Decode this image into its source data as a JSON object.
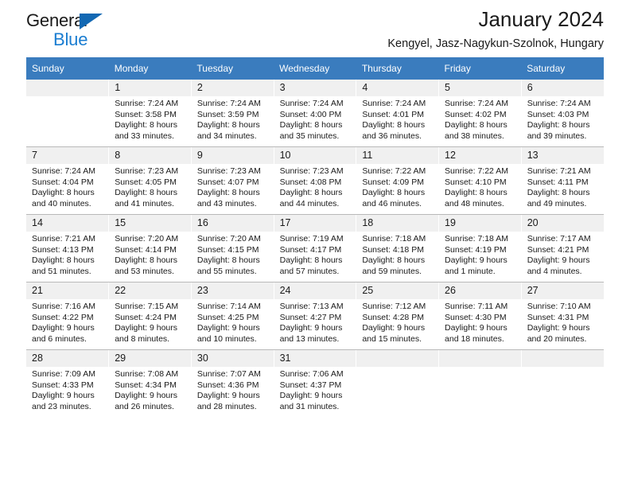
{
  "logo": {
    "word1": "General",
    "word2": "Blue",
    "triangle_color": "#1268b3",
    "word2_color": "#1a7dd1"
  },
  "header": {
    "title": "January 2024",
    "subtitle": "Kengyel, Jasz-Nagykun-Szolnok, Hungary",
    "header_bg": "#3a7cbe",
    "daynum_bg": "#f0f0f0"
  },
  "weekdays": [
    "Sunday",
    "Monday",
    "Tuesday",
    "Wednesday",
    "Thursday",
    "Friday",
    "Saturday"
  ],
  "weeks": [
    [
      {
        "day": "",
        "lines": []
      },
      {
        "day": "1",
        "lines": [
          "Sunrise: 7:24 AM",
          "Sunset: 3:58 PM",
          "Daylight: 8 hours",
          "and 33 minutes."
        ]
      },
      {
        "day": "2",
        "lines": [
          "Sunrise: 7:24 AM",
          "Sunset: 3:59 PM",
          "Daylight: 8 hours",
          "and 34 minutes."
        ]
      },
      {
        "day": "3",
        "lines": [
          "Sunrise: 7:24 AM",
          "Sunset: 4:00 PM",
          "Daylight: 8 hours",
          "and 35 minutes."
        ]
      },
      {
        "day": "4",
        "lines": [
          "Sunrise: 7:24 AM",
          "Sunset: 4:01 PM",
          "Daylight: 8 hours",
          "and 36 minutes."
        ]
      },
      {
        "day": "5",
        "lines": [
          "Sunrise: 7:24 AM",
          "Sunset: 4:02 PM",
          "Daylight: 8 hours",
          "and 38 minutes."
        ]
      },
      {
        "day": "6",
        "lines": [
          "Sunrise: 7:24 AM",
          "Sunset: 4:03 PM",
          "Daylight: 8 hours",
          "and 39 minutes."
        ]
      }
    ],
    [
      {
        "day": "7",
        "lines": [
          "Sunrise: 7:24 AM",
          "Sunset: 4:04 PM",
          "Daylight: 8 hours",
          "and 40 minutes."
        ]
      },
      {
        "day": "8",
        "lines": [
          "Sunrise: 7:23 AM",
          "Sunset: 4:05 PM",
          "Daylight: 8 hours",
          "and 41 minutes."
        ]
      },
      {
        "day": "9",
        "lines": [
          "Sunrise: 7:23 AM",
          "Sunset: 4:07 PM",
          "Daylight: 8 hours",
          "and 43 minutes."
        ]
      },
      {
        "day": "10",
        "lines": [
          "Sunrise: 7:23 AM",
          "Sunset: 4:08 PM",
          "Daylight: 8 hours",
          "and 44 minutes."
        ]
      },
      {
        "day": "11",
        "lines": [
          "Sunrise: 7:22 AM",
          "Sunset: 4:09 PM",
          "Daylight: 8 hours",
          "and 46 minutes."
        ]
      },
      {
        "day": "12",
        "lines": [
          "Sunrise: 7:22 AM",
          "Sunset: 4:10 PM",
          "Daylight: 8 hours",
          "and 48 minutes."
        ]
      },
      {
        "day": "13",
        "lines": [
          "Sunrise: 7:21 AM",
          "Sunset: 4:11 PM",
          "Daylight: 8 hours",
          "and 49 minutes."
        ]
      }
    ],
    [
      {
        "day": "14",
        "lines": [
          "Sunrise: 7:21 AM",
          "Sunset: 4:13 PM",
          "Daylight: 8 hours",
          "and 51 minutes."
        ]
      },
      {
        "day": "15",
        "lines": [
          "Sunrise: 7:20 AM",
          "Sunset: 4:14 PM",
          "Daylight: 8 hours",
          "and 53 minutes."
        ]
      },
      {
        "day": "16",
        "lines": [
          "Sunrise: 7:20 AM",
          "Sunset: 4:15 PM",
          "Daylight: 8 hours",
          "and 55 minutes."
        ]
      },
      {
        "day": "17",
        "lines": [
          "Sunrise: 7:19 AM",
          "Sunset: 4:17 PM",
          "Daylight: 8 hours",
          "and 57 minutes."
        ]
      },
      {
        "day": "18",
        "lines": [
          "Sunrise: 7:18 AM",
          "Sunset: 4:18 PM",
          "Daylight: 8 hours",
          "and 59 minutes."
        ]
      },
      {
        "day": "19",
        "lines": [
          "Sunrise: 7:18 AM",
          "Sunset: 4:19 PM",
          "Daylight: 9 hours",
          "and 1 minute."
        ]
      },
      {
        "day": "20",
        "lines": [
          "Sunrise: 7:17 AM",
          "Sunset: 4:21 PM",
          "Daylight: 9 hours",
          "and 4 minutes."
        ]
      }
    ],
    [
      {
        "day": "21",
        "lines": [
          "Sunrise: 7:16 AM",
          "Sunset: 4:22 PM",
          "Daylight: 9 hours",
          "and 6 minutes."
        ]
      },
      {
        "day": "22",
        "lines": [
          "Sunrise: 7:15 AM",
          "Sunset: 4:24 PM",
          "Daylight: 9 hours",
          "and 8 minutes."
        ]
      },
      {
        "day": "23",
        "lines": [
          "Sunrise: 7:14 AM",
          "Sunset: 4:25 PM",
          "Daylight: 9 hours",
          "and 10 minutes."
        ]
      },
      {
        "day": "24",
        "lines": [
          "Sunrise: 7:13 AM",
          "Sunset: 4:27 PM",
          "Daylight: 9 hours",
          "and 13 minutes."
        ]
      },
      {
        "day": "25",
        "lines": [
          "Sunrise: 7:12 AM",
          "Sunset: 4:28 PM",
          "Daylight: 9 hours",
          "and 15 minutes."
        ]
      },
      {
        "day": "26",
        "lines": [
          "Sunrise: 7:11 AM",
          "Sunset: 4:30 PM",
          "Daylight: 9 hours",
          "and 18 minutes."
        ]
      },
      {
        "day": "27",
        "lines": [
          "Sunrise: 7:10 AM",
          "Sunset: 4:31 PM",
          "Daylight: 9 hours",
          "and 20 minutes."
        ]
      }
    ],
    [
      {
        "day": "28",
        "lines": [
          "Sunrise: 7:09 AM",
          "Sunset: 4:33 PM",
          "Daylight: 9 hours",
          "and 23 minutes."
        ]
      },
      {
        "day": "29",
        "lines": [
          "Sunrise: 7:08 AM",
          "Sunset: 4:34 PM",
          "Daylight: 9 hours",
          "and 26 minutes."
        ]
      },
      {
        "day": "30",
        "lines": [
          "Sunrise: 7:07 AM",
          "Sunset: 4:36 PM",
          "Daylight: 9 hours",
          "and 28 minutes."
        ]
      },
      {
        "day": "31",
        "lines": [
          "Sunrise: 7:06 AM",
          "Sunset: 4:37 PM",
          "Daylight: 9 hours",
          "and 31 minutes."
        ]
      },
      {
        "day": "",
        "lines": []
      },
      {
        "day": "",
        "lines": []
      },
      {
        "day": "",
        "lines": []
      }
    ]
  ]
}
